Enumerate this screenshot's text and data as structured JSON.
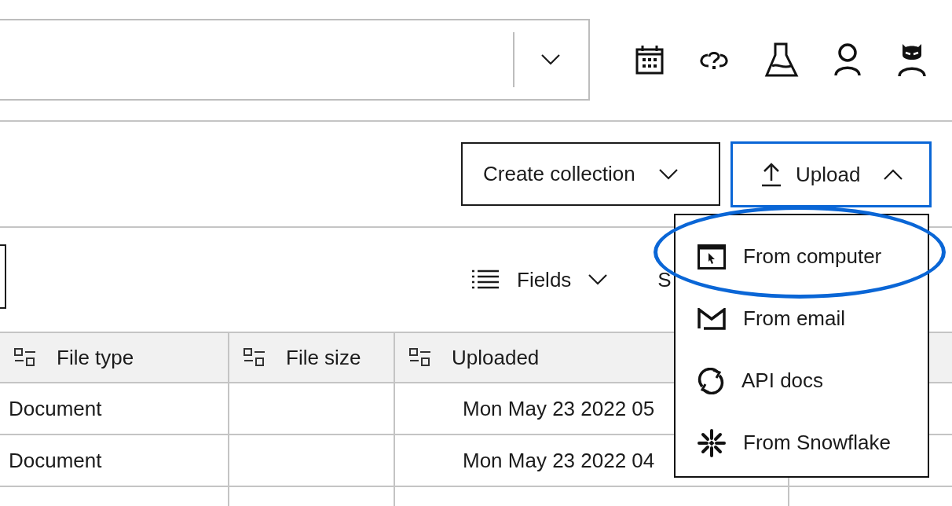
{
  "toolbar": {
    "buttons": [
      {
        "label": "Create collection",
        "expanded": false,
        "focused": false
      },
      {
        "label": "Upload",
        "expanded": true,
        "focused": true,
        "kind": "upload"
      }
    ]
  },
  "view_bar": {
    "fields_button": {
      "label": "Fields",
      "expanded": false
    },
    "hidden_label": "S"
  },
  "table": {
    "columns": [
      "File type",
      "File size",
      "Uploaded"
    ],
    "rows": [
      {
        "file_type": "Document",
        "uploaded": "Mon May 23 2022 05"
      },
      {
        "file_type": "Document",
        "uploaded": "Mon May 23 2022 04"
      }
    ]
  },
  "upload_menu": {
    "items": [
      {
        "label": "From computer",
        "kind": "computer",
        "circled": true
      },
      {
        "label": "From email",
        "kind": "email",
        "circled": false
      },
      {
        "label": "API docs",
        "kind": "api",
        "circled": false
      },
      {
        "label": "From Snowflake",
        "kind": "snowflake",
        "circled": false
      }
    ]
  }
}
